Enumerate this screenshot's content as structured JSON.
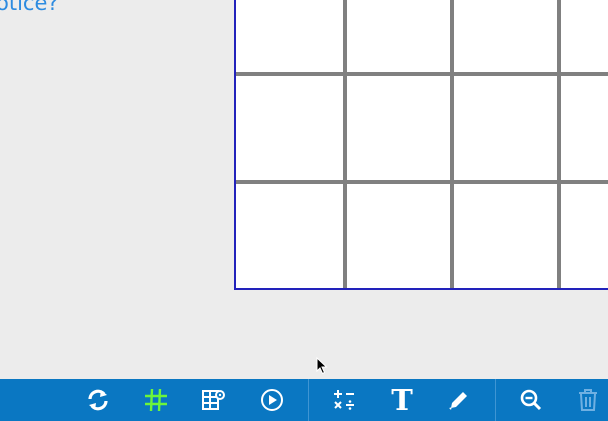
{
  "prompt": {
    "text": "otice?",
    "color": "#2d8be0"
  },
  "board": {
    "border_color": "#2222bb",
    "line_color": "#808080",
    "cell_color": "#ffffff"
  },
  "toolbar": {
    "background": "#0a77c2",
    "tools": [
      {
        "name": "refresh-icon",
        "active": false
      },
      {
        "name": "hash-grid-icon",
        "active": true,
        "color": "#6cf53a"
      },
      {
        "name": "grid-settings-icon",
        "active": false
      },
      {
        "name": "play-circle-icon",
        "active": false
      },
      {
        "name": "operations-icon",
        "active": false
      },
      {
        "name": "text-icon",
        "label": "T",
        "active": false
      },
      {
        "name": "pencil-icon",
        "active": false
      },
      {
        "name": "zoom-out-icon",
        "active": false
      },
      {
        "name": "trash-icon",
        "active": false,
        "disabled": true
      }
    ]
  }
}
